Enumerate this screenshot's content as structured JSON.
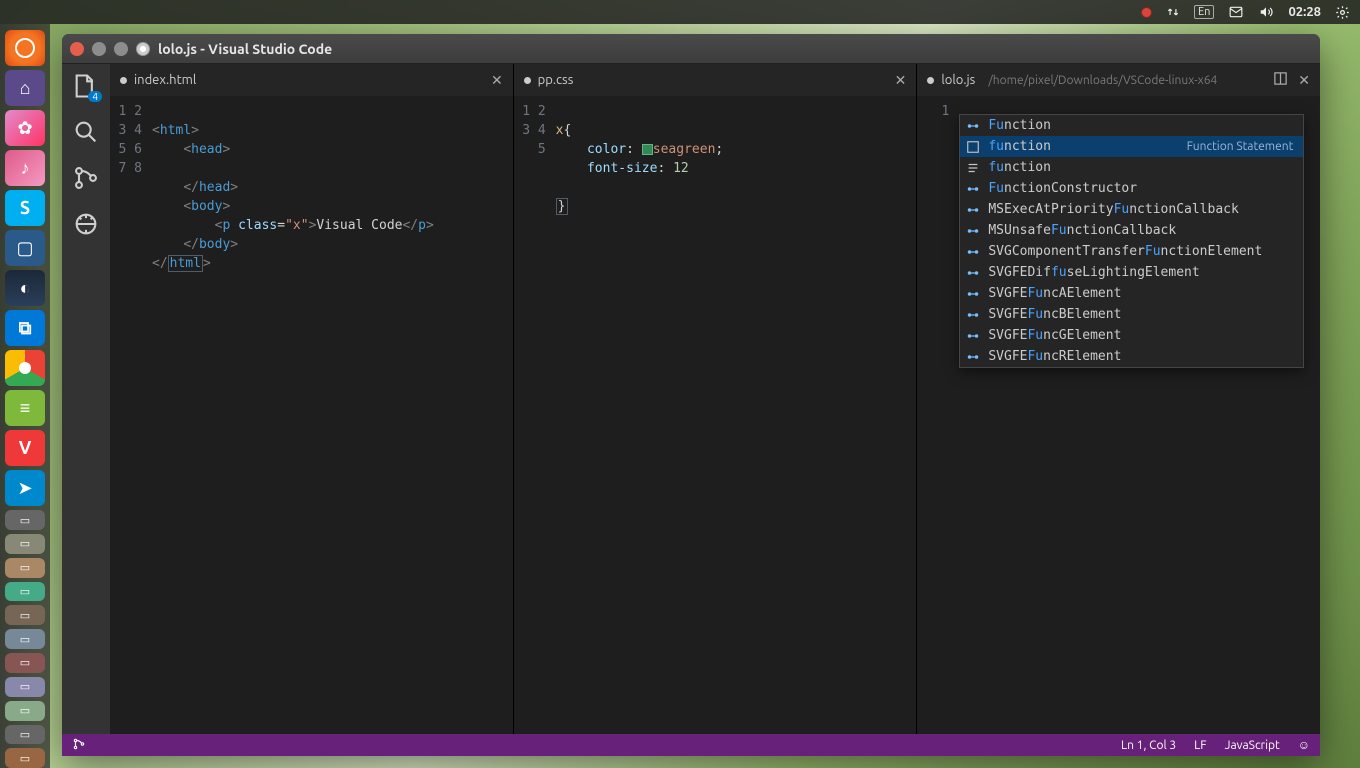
{
  "system": {
    "clock": "02:28",
    "keyboard_indicator": "En"
  },
  "launcher_icons": [
    "ubuntu-dash",
    "design-app",
    "swirl-app",
    "music-app",
    "skype",
    "screenshot-app",
    "steam",
    "vscode",
    "chrome",
    "docs",
    "vivaldi",
    "telegram",
    "app-a",
    "app-b",
    "app-c",
    "app-d",
    "app-e",
    "app-f",
    "app-g",
    "app-h",
    "app-i",
    "app-j",
    "app-k"
  ],
  "window": {
    "title": "lolo.js - Visual Studio Code"
  },
  "activitybar": {
    "explorer_badge": "4"
  },
  "groups": [
    {
      "tab": {
        "name": "index.html",
        "modified": true
      },
      "lines": [
        "1",
        "2",
        "3",
        "4",
        "5",
        "6",
        "7",
        "8"
      ],
      "html": {
        "l1_open": "<",
        "l1_tag": "html",
        "l1_close": ">",
        "l2_open": "<",
        "l2_tag": "head",
        "l2_close": ">",
        "l4_open": "</",
        "l4_tag": "head",
        "l4_close": ">",
        "l5_open": "<",
        "l5_tag": "body",
        "l5_close": ">",
        "l6_open": "<",
        "l6_tag": "p",
        "l6_sp": " ",
        "l6_attr": "class",
        "l6_eq": "=",
        "l6_str": "\"x\"",
        "l6_close": ">",
        "l6_txt": "Visual Code",
        "l6_copen": "</",
        "l6_ctag": "p",
        "l6_cclose": ">",
        "l7_open": "</",
        "l7_tag": "body",
        "l7_close": ">",
        "l8_open": "</",
        "l8_tag": "html",
        "l8_close": ">"
      }
    },
    {
      "tab": {
        "name": "pp.css",
        "modified": true
      },
      "lines": [
        "1",
        "2",
        "3",
        "4",
        "5"
      ],
      "css": {
        "l1_sel": "x",
        "l1_brace": "{",
        "l2_prop": "color",
        "l2_colon": ": ",
        "l2_val": "seagreen",
        "l2_semi": ";",
        "l3_prop": "font-size",
        "l3_colon": ": ",
        "l3_val": "12",
        "l5_brace": "}"
      }
    },
    {
      "tab": {
        "name": "lolo.js",
        "modified": true,
        "path": "/home/pixel/Downloads/VSCode-linux-x64"
      },
      "lines": [
        "1"
      ],
      "js": {
        "typed": "fu"
      },
      "suggestions": [
        {
          "type": "class",
          "pre": "Fu",
          "rest": "nction",
          "hint": ""
        },
        {
          "type": "snippet",
          "pre": "fu",
          "rest": "nction",
          "hint": "Function Statement",
          "selected": true
        },
        {
          "type": "text",
          "pre": "fu",
          "rest": "nction",
          "hint": ""
        },
        {
          "type": "class",
          "pre": "Fu",
          "rest": "nctionConstructor"
        },
        {
          "type": "class",
          "before": "MSExecAtPriority",
          "pre": "Fu",
          "rest": "nctionCallback"
        },
        {
          "type": "class",
          "before": "MSUnsafe",
          "pre": "Fu",
          "rest": "nctionCallback"
        },
        {
          "type": "class",
          "before": "SVGComponentTransfer",
          "pre": "Fu",
          "rest": "nctionElement"
        },
        {
          "type": "class",
          "before": "SVGFEDif",
          "pre": "fu",
          "rest": "seLightingElement"
        },
        {
          "type": "class",
          "before": "SVGFE",
          "pre": "Fu",
          "rest": "ncAElement"
        },
        {
          "type": "class",
          "before": "SVGFE",
          "pre": "Fu",
          "rest": "ncBElement"
        },
        {
          "type": "class",
          "before": "SVGFE",
          "pre": "Fu",
          "rest": "ncGElement"
        },
        {
          "type": "class",
          "before": "SVGFE",
          "pre": "Fu",
          "rest": "ncRElement"
        }
      ]
    }
  ],
  "statusbar": {
    "position": "Ln 1, Col 3",
    "eol": "LF",
    "language": "JavaScript"
  }
}
